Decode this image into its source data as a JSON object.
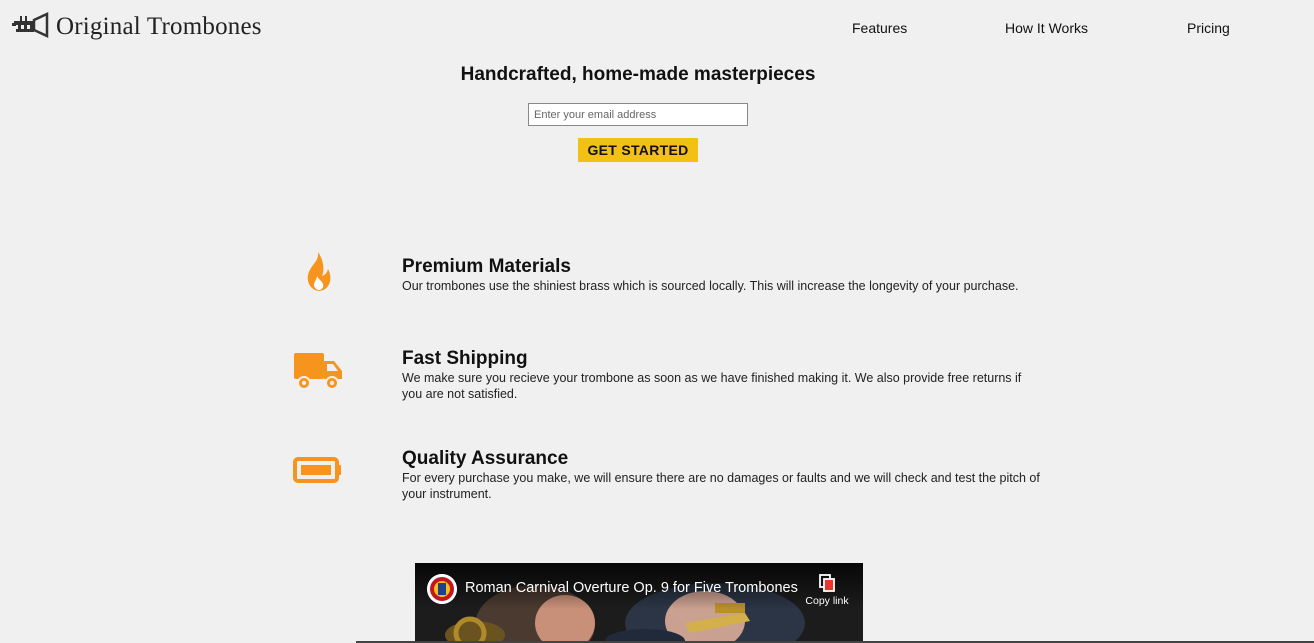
{
  "header": {
    "logo_text": "Original Trombones",
    "logo_icon": "trumpet-icon"
  },
  "nav": {
    "features": "Features",
    "how_it_works": "How It Works",
    "pricing": "Pricing"
  },
  "hero": {
    "title": "Handcrafted, home-made masterpieces",
    "email_placeholder": "Enter your email address",
    "cta_label": "GET STARTED"
  },
  "features": [
    {
      "icon": "fire-icon",
      "title": "Premium Materials",
      "description": "Our trombones use the shiniest brass which is sourced locally. This will increase the longevity of your purchase."
    },
    {
      "icon": "truck-icon",
      "title": "Fast Shipping",
      "description": "We make sure you recieve your trombone as soon as we have finished making it. We also provide free returns if you are not satisfied."
    },
    {
      "icon": "battery-full-icon",
      "title": "Quality Assurance",
      "description": "For every purchase you make, we will ensure there are no damages or faults and we will check and test the pitch of your instrument."
    }
  ],
  "video": {
    "title": "Roman Carnival Overture Op. 9 for Five Trombones",
    "copy_link_label": "Copy link"
  },
  "colors": {
    "background": "#f0f0f0",
    "accent_orange": "#f7941d",
    "cta_yellow": "#f2c114"
  }
}
